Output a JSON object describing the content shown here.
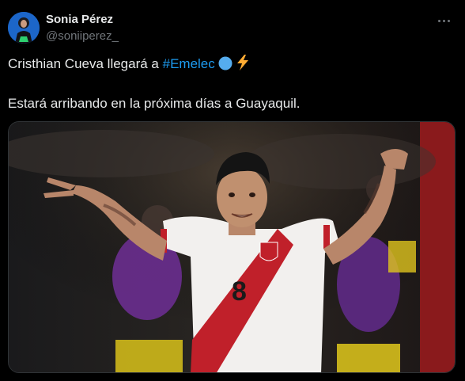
{
  "author": {
    "name": "Sonia Pérez",
    "handle": "@soniiperez_"
  },
  "tweet": {
    "line1_text": "Cristhian Cueva llegará a ",
    "hashtag": "#Emelec",
    "line2_text": "Estará arribando en la próxima días a Guayaquil."
  },
  "media": {
    "jersey_number": "8"
  },
  "colors": {
    "background": "#000000",
    "text": "#e7e9ea",
    "secondary_text": "#71767b",
    "link": "#1d9bf0"
  },
  "icons": {
    "more": "more-options-icon",
    "emoji_1": "blue-circle-emoji-icon",
    "emoji_2": "lightning-emoji-icon"
  }
}
